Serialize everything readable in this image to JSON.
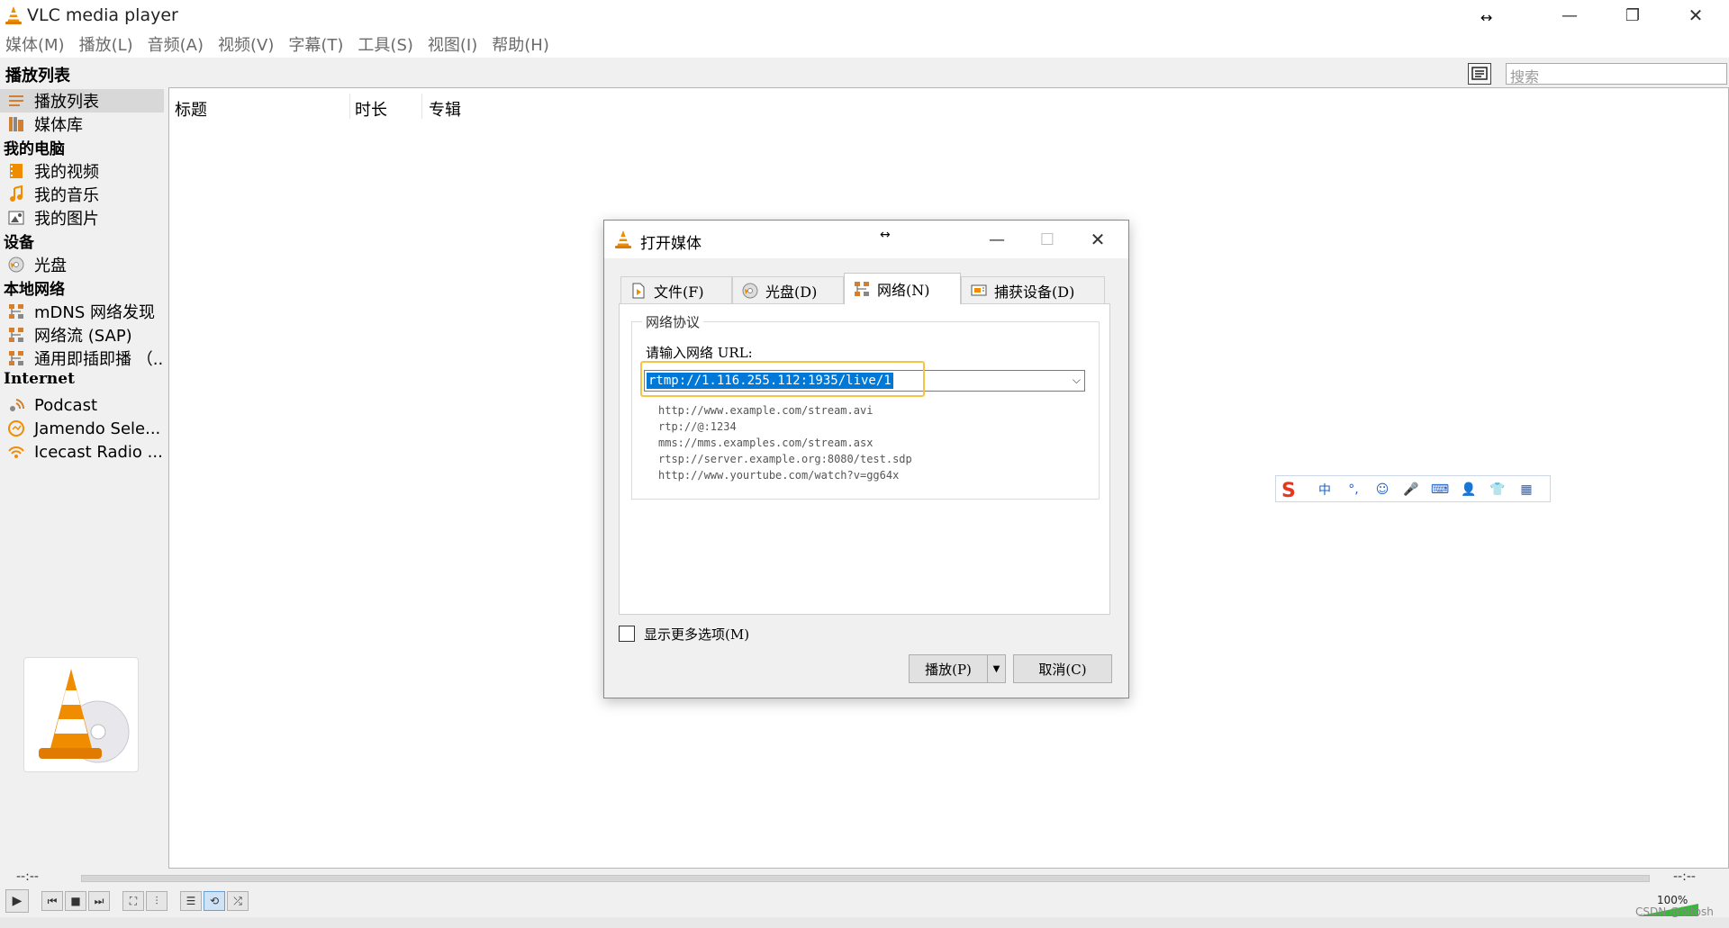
{
  "window": {
    "title": "VLC media player",
    "minimize_glyph": "—",
    "restore_glyph": "❐",
    "close_glyph": "✕",
    "resize_glyph": "↔"
  },
  "menu": [
    "媒体(M)",
    "播放(L)",
    "音频(A)",
    "视频(V)",
    "字幕(T)",
    "工具(S)",
    "视图(I)",
    "帮助(H)"
  ],
  "playlist": {
    "header": "播放列表",
    "search_placeholder": "搜索",
    "columns": [
      "标题",
      "时长",
      "专辑"
    ]
  },
  "sidebar": {
    "items": [
      {
        "label": "播放列表",
        "icon": "playlist-icon",
        "selected": true
      },
      {
        "label": "媒体库",
        "icon": "media-library-icon"
      }
    ],
    "groups": [
      {
        "title": "我的电脑",
        "items": [
          {
            "label": "我的视频",
            "icon": "video-icon"
          },
          {
            "label": "我的音乐",
            "icon": "music-icon"
          },
          {
            "label": "我的图片",
            "icon": "picture-icon"
          }
        ]
      },
      {
        "title": "设备",
        "items": [
          {
            "label": "光盘",
            "icon": "disc-icon"
          }
        ]
      },
      {
        "title": "本地网络",
        "items": [
          {
            "label": "mDNS 网络发现",
            "icon": "network-icon"
          },
          {
            "label": "网络流 (SAP)",
            "icon": "network-icon"
          },
          {
            "label": "通用即插即播 （...",
            "icon": "network-icon"
          }
        ]
      },
      {
        "title": "Internet",
        "items": [
          {
            "label": "Podcast",
            "icon": "podcast-icon"
          },
          {
            "label": "Jamendo Sele...",
            "icon": "jamendo-icon"
          },
          {
            "label": "Icecast Radio ...",
            "icon": "radio-icon"
          }
        ]
      }
    ]
  },
  "controls": {
    "time_elapsed": "--:--",
    "time_total": "--:--",
    "volume": "100%",
    "volume_level": 1.0
  },
  "watermark": "CSDN @bitosh",
  "dialog": {
    "title": "打开媒体",
    "tabs": [
      {
        "label": "文件(F)",
        "icon": "file-icon"
      },
      {
        "label": "光盘(D)",
        "icon": "disc-icon"
      },
      {
        "label": "网络(N)",
        "icon": "network-icon",
        "active": true
      },
      {
        "label": "捕获设备(D)",
        "icon": "capture-icon"
      }
    ],
    "group_title": "网络协议",
    "url_label": "请输入网络 URL:",
    "url_value": "rtmp://1.116.255.112:1935/live/1",
    "examples": [
      "http://www.example.com/stream.avi",
      "rtp://@:1234",
      "mms://mms.examples.com/stream.asx",
      "rtsp://server.example.org:8080/test.sdp",
      "http://www.yourtube.com/watch?v=gg64x"
    ],
    "more_options": "显示更多选项(M)",
    "more_options_checked": false,
    "play_button": "播放(P)",
    "cancel_button": "取消(C)"
  },
  "ime_toolbar": {
    "items": [
      "中",
      "°,",
      "☺",
      "🎤",
      "⌨",
      "👤",
      "👕",
      "▦"
    ]
  },
  "colors": {
    "accent": "#0078d7",
    "vlc_orange": "#f08c00",
    "highlight_box": "#f5c542",
    "ime_blue": "#2060c8"
  }
}
